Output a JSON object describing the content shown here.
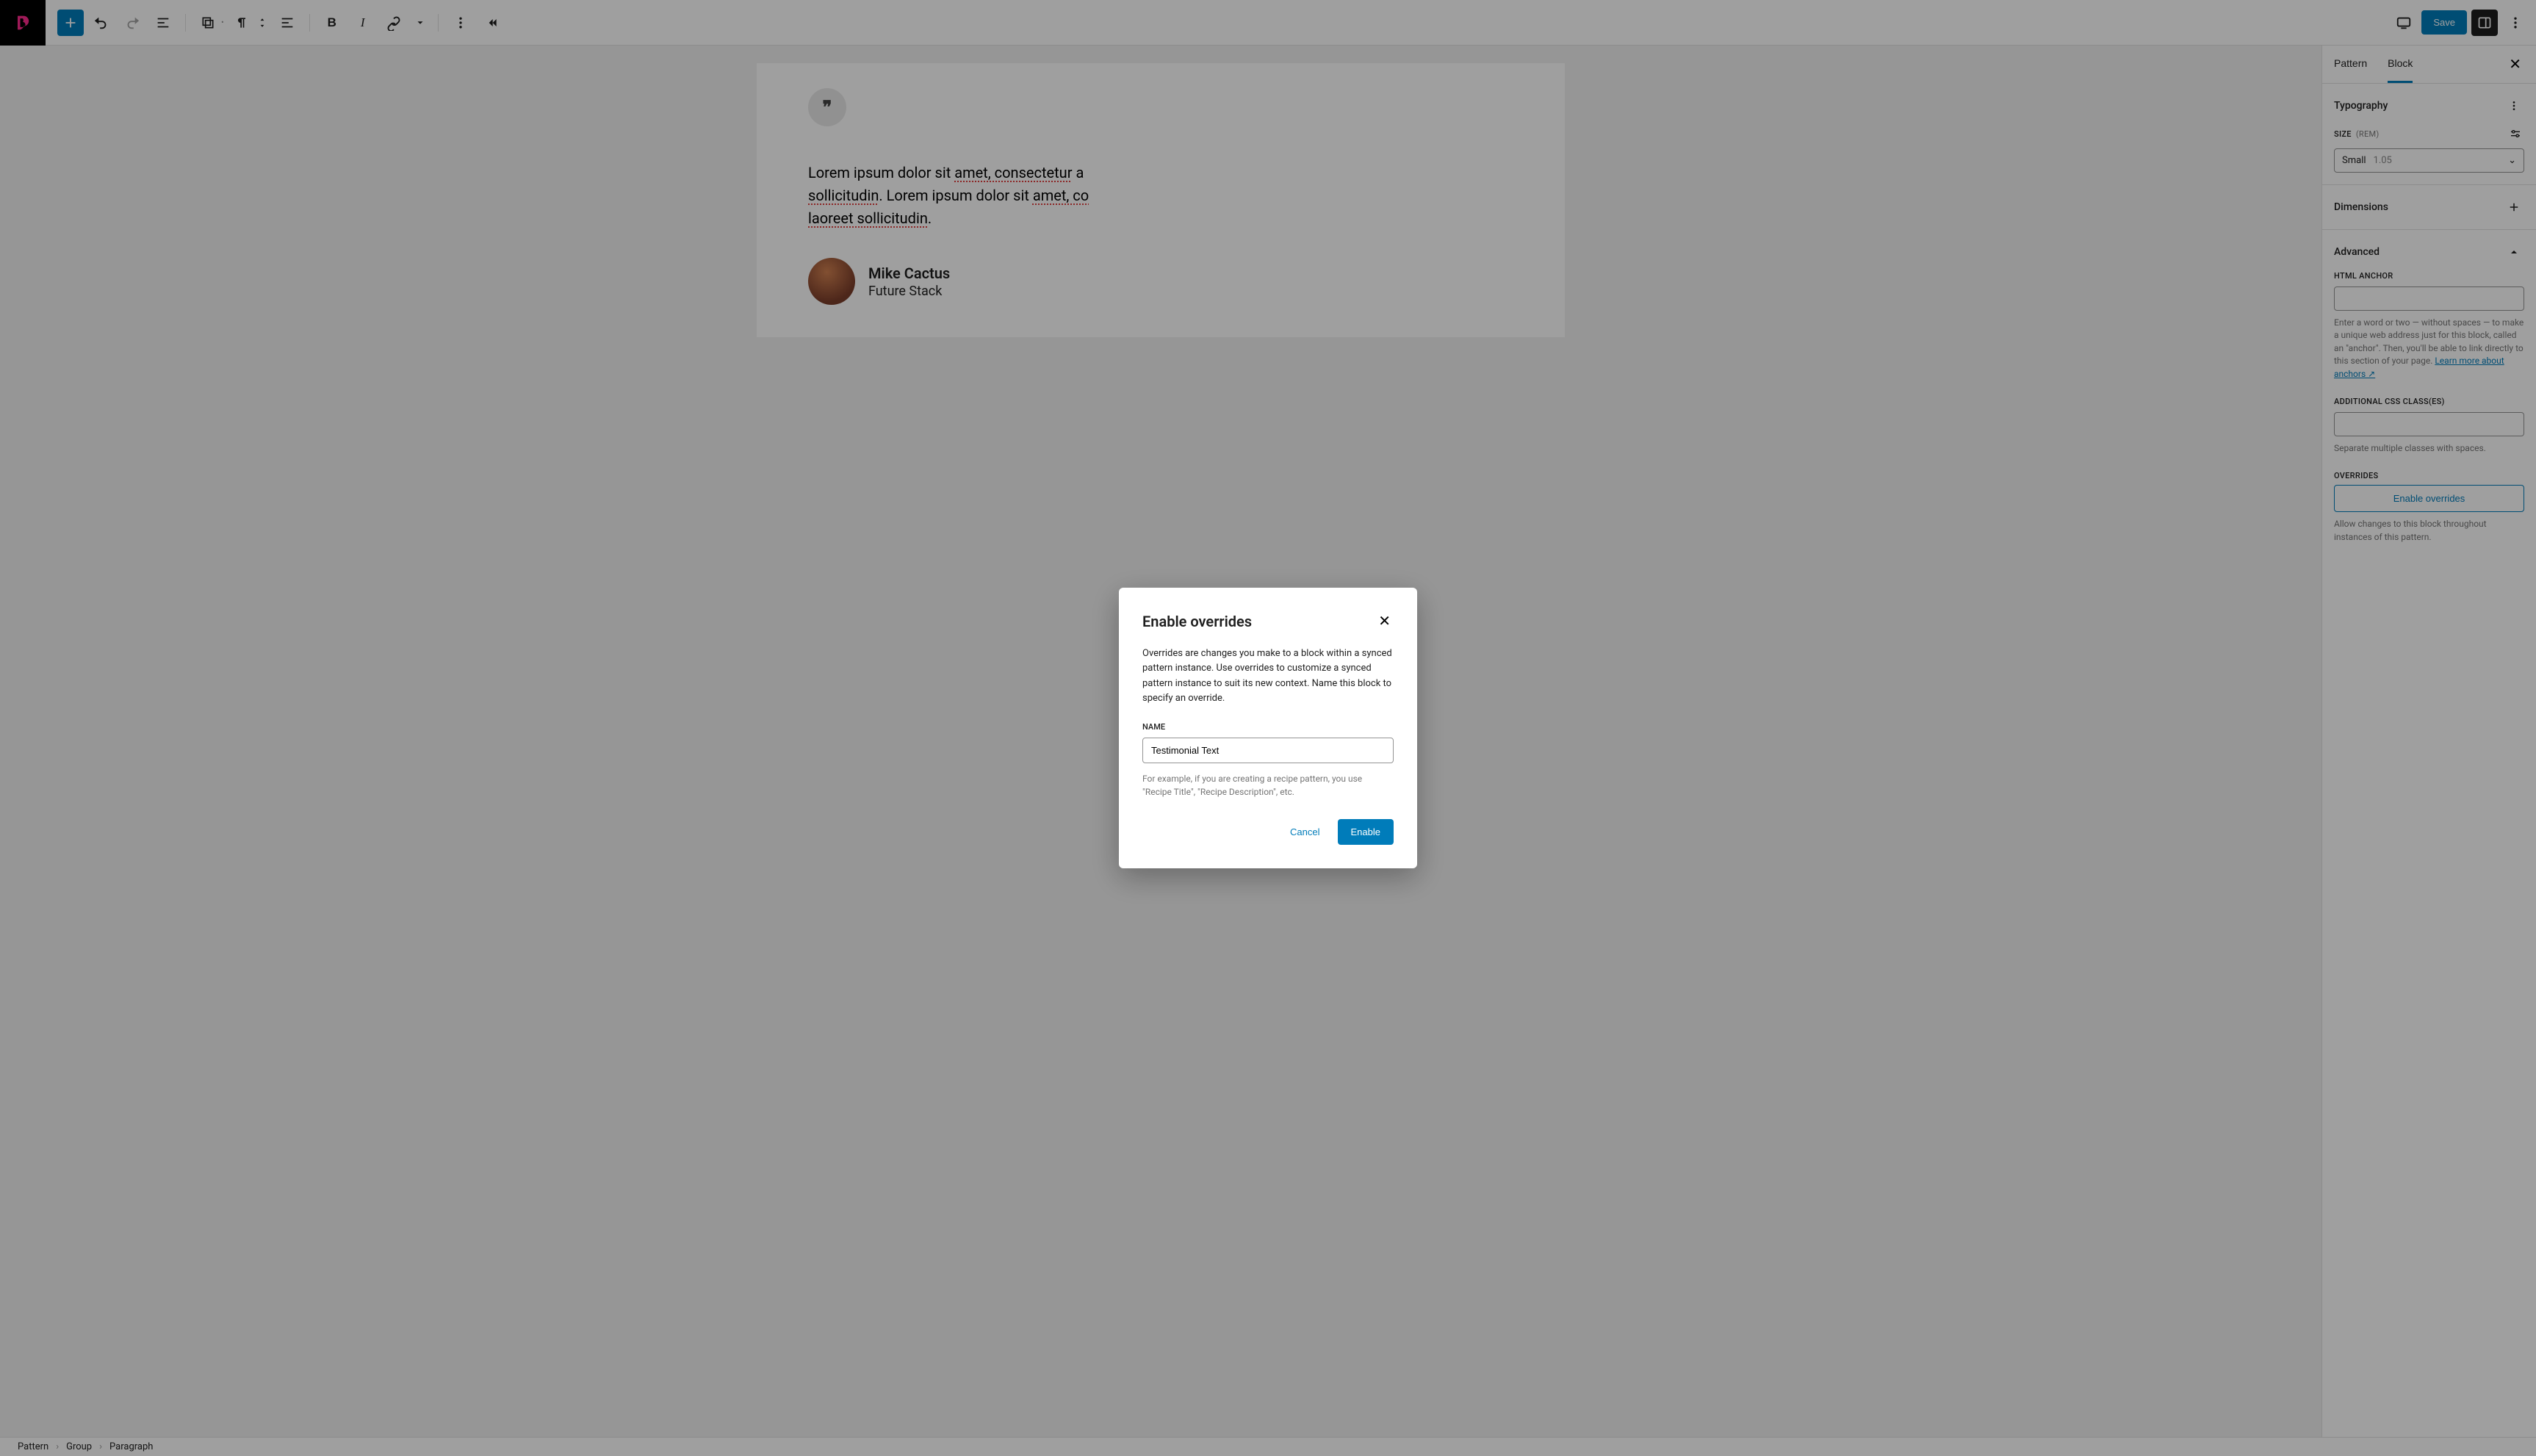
{
  "toolbar": {
    "save_label": "Save"
  },
  "canvas": {
    "quote_text_parts": {
      "a": "Lorem ipsum dolor sit ",
      "b": "amet, consectetur",
      "c": " a",
      "d": ". Lorem ipsum dolor sit ",
      "e": "amet, co",
      "f": "laoreet sollicitudin",
      "g": "sollicitudin",
      "h": "."
    },
    "author_name": "Mike Cactus",
    "author_position": "Future Stack"
  },
  "sidebar": {
    "tabs": {
      "pattern": "Pattern",
      "block": "Block"
    },
    "typography": {
      "title": "Typography",
      "size_label": "Size",
      "size_unit": "(rem)",
      "size_value": "Small",
      "size_num": "1.05"
    },
    "dimensions": {
      "title": "Dimensions"
    },
    "advanced": {
      "title": "Advanced",
      "anchor_label": "HTML anchor",
      "anchor_help": "Enter a word or two — without spaces — to make a unique web address just for this block, called an \"anchor\". Then, you'll be able to link directly to this section of your page. ",
      "anchor_link": "Learn more about anchors ↗",
      "css_label": "Additional CSS class(es)",
      "css_help": "Separate multiple classes with spaces.",
      "overrides_label": "Overrides",
      "enable_btn": "Enable overrides",
      "overrides_help": "Allow changes to this block throughout instances of this pattern."
    }
  },
  "breadcrumb": {
    "a": "Pattern",
    "b": "Group",
    "c": "Paragraph"
  },
  "modal": {
    "title": "Enable overrides",
    "description": "Overrides are changes you make to a block within a synced pattern instance. Use overrides to customize a synced pattern instance to suit its new context. Name this block to specify an override.",
    "name_label": "Name",
    "name_value": "Testimonial Text",
    "hint": "For example, if you are creating a recipe pattern, you use \"Recipe Title\", \"Recipe Description\", etc.",
    "cancel": "Cancel",
    "enable": "Enable"
  }
}
